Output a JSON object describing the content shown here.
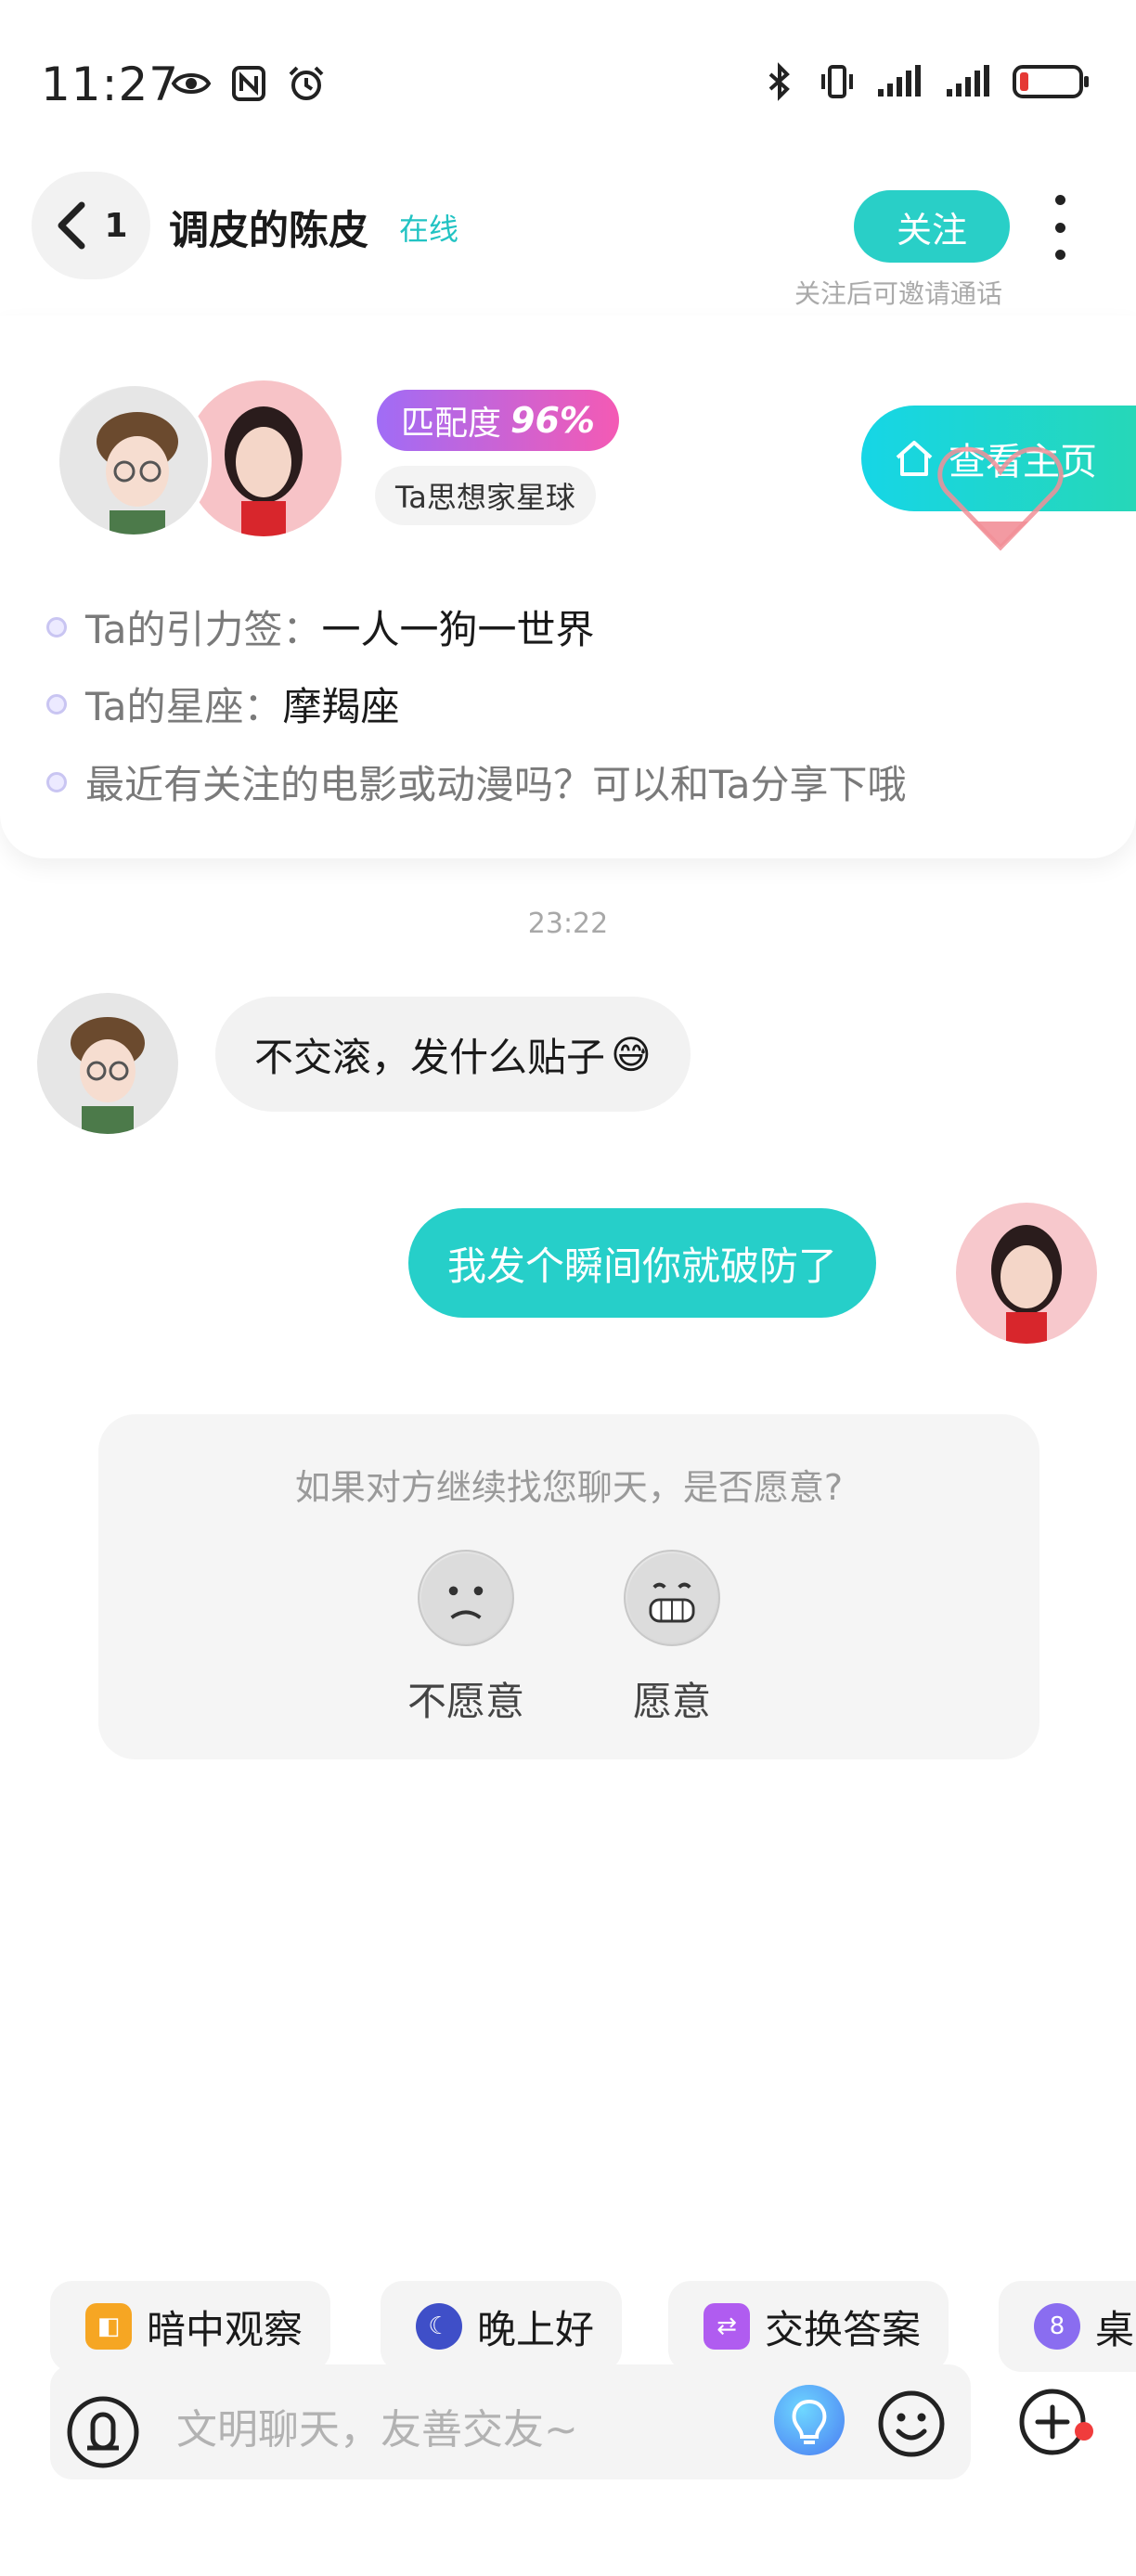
{
  "status_bar": {
    "time": "11:27",
    "left_icons": [
      "eye-icon",
      "nfc-icon",
      "alarm-icon"
    ],
    "right_icons": [
      "bluetooth-icon",
      "vibrate-icon",
      "signal-icon",
      "signal-icon",
      "battery-low-icon"
    ],
    "battery_color": "#e53935"
  },
  "header": {
    "back_count": "1",
    "nickname": "调皮的陈皮",
    "online_status": "在线",
    "follow_label": "关注",
    "follow_hint": "关注后可邀请通话"
  },
  "profile_card": {
    "match_label": "匹配度",
    "match_value": "96%",
    "planet_tag": "Ta思想家星球",
    "home_button": "查看主页",
    "info": [
      {
        "key": "Ta的引力签：",
        "value": "一人一狗一世界"
      },
      {
        "key": "Ta的星座：",
        "value": "摩羯座"
      },
      {
        "key": "",
        "value": "最近有关注的电影或动漫吗？可以和Ta分享下哦"
      }
    ]
  },
  "chat": {
    "timestamp": "23:22",
    "messages": [
      {
        "side": "left",
        "text": "不交滚，发什么贴子",
        "emoji": "😅"
      },
      {
        "side": "right",
        "text": "我发个瞬间你就破防了"
      }
    ]
  },
  "willingness": {
    "question": "如果对方继续找您聊天，是否愿意?",
    "options": [
      {
        "label": "不愿意",
        "icon": "sad-face-icon"
      },
      {
        "label": "愿意",
        "icon": "grin-face-icon"
      }
    ]
  },
  "quick_replies": [
    {
      "label": "暗中观察",
      "icon": "peek-cat-icon",
      "color": "#f6a623"
    },
    {
      "label": "晚上好",
      "icon": "moon-icon",
      "color": "#3f4fc8"
    },
    {
      "label": "交换答案",
      "icon": "swap-icon",
      "color": "#b05cf0"
    },
    {
      "label": "桌",
      "icon": "eight-ball-icon",
      "color": "#8a6df0"
    }
  ],
  "input": {
    "placeholder": "文明聊天，友善交友~"
  },
  "colors": {
    "accent": "#29cfc7",
    "match_gradient_start": "#a06cf6",
    "match_gradient_end": "#f45ab4"
  }
}
